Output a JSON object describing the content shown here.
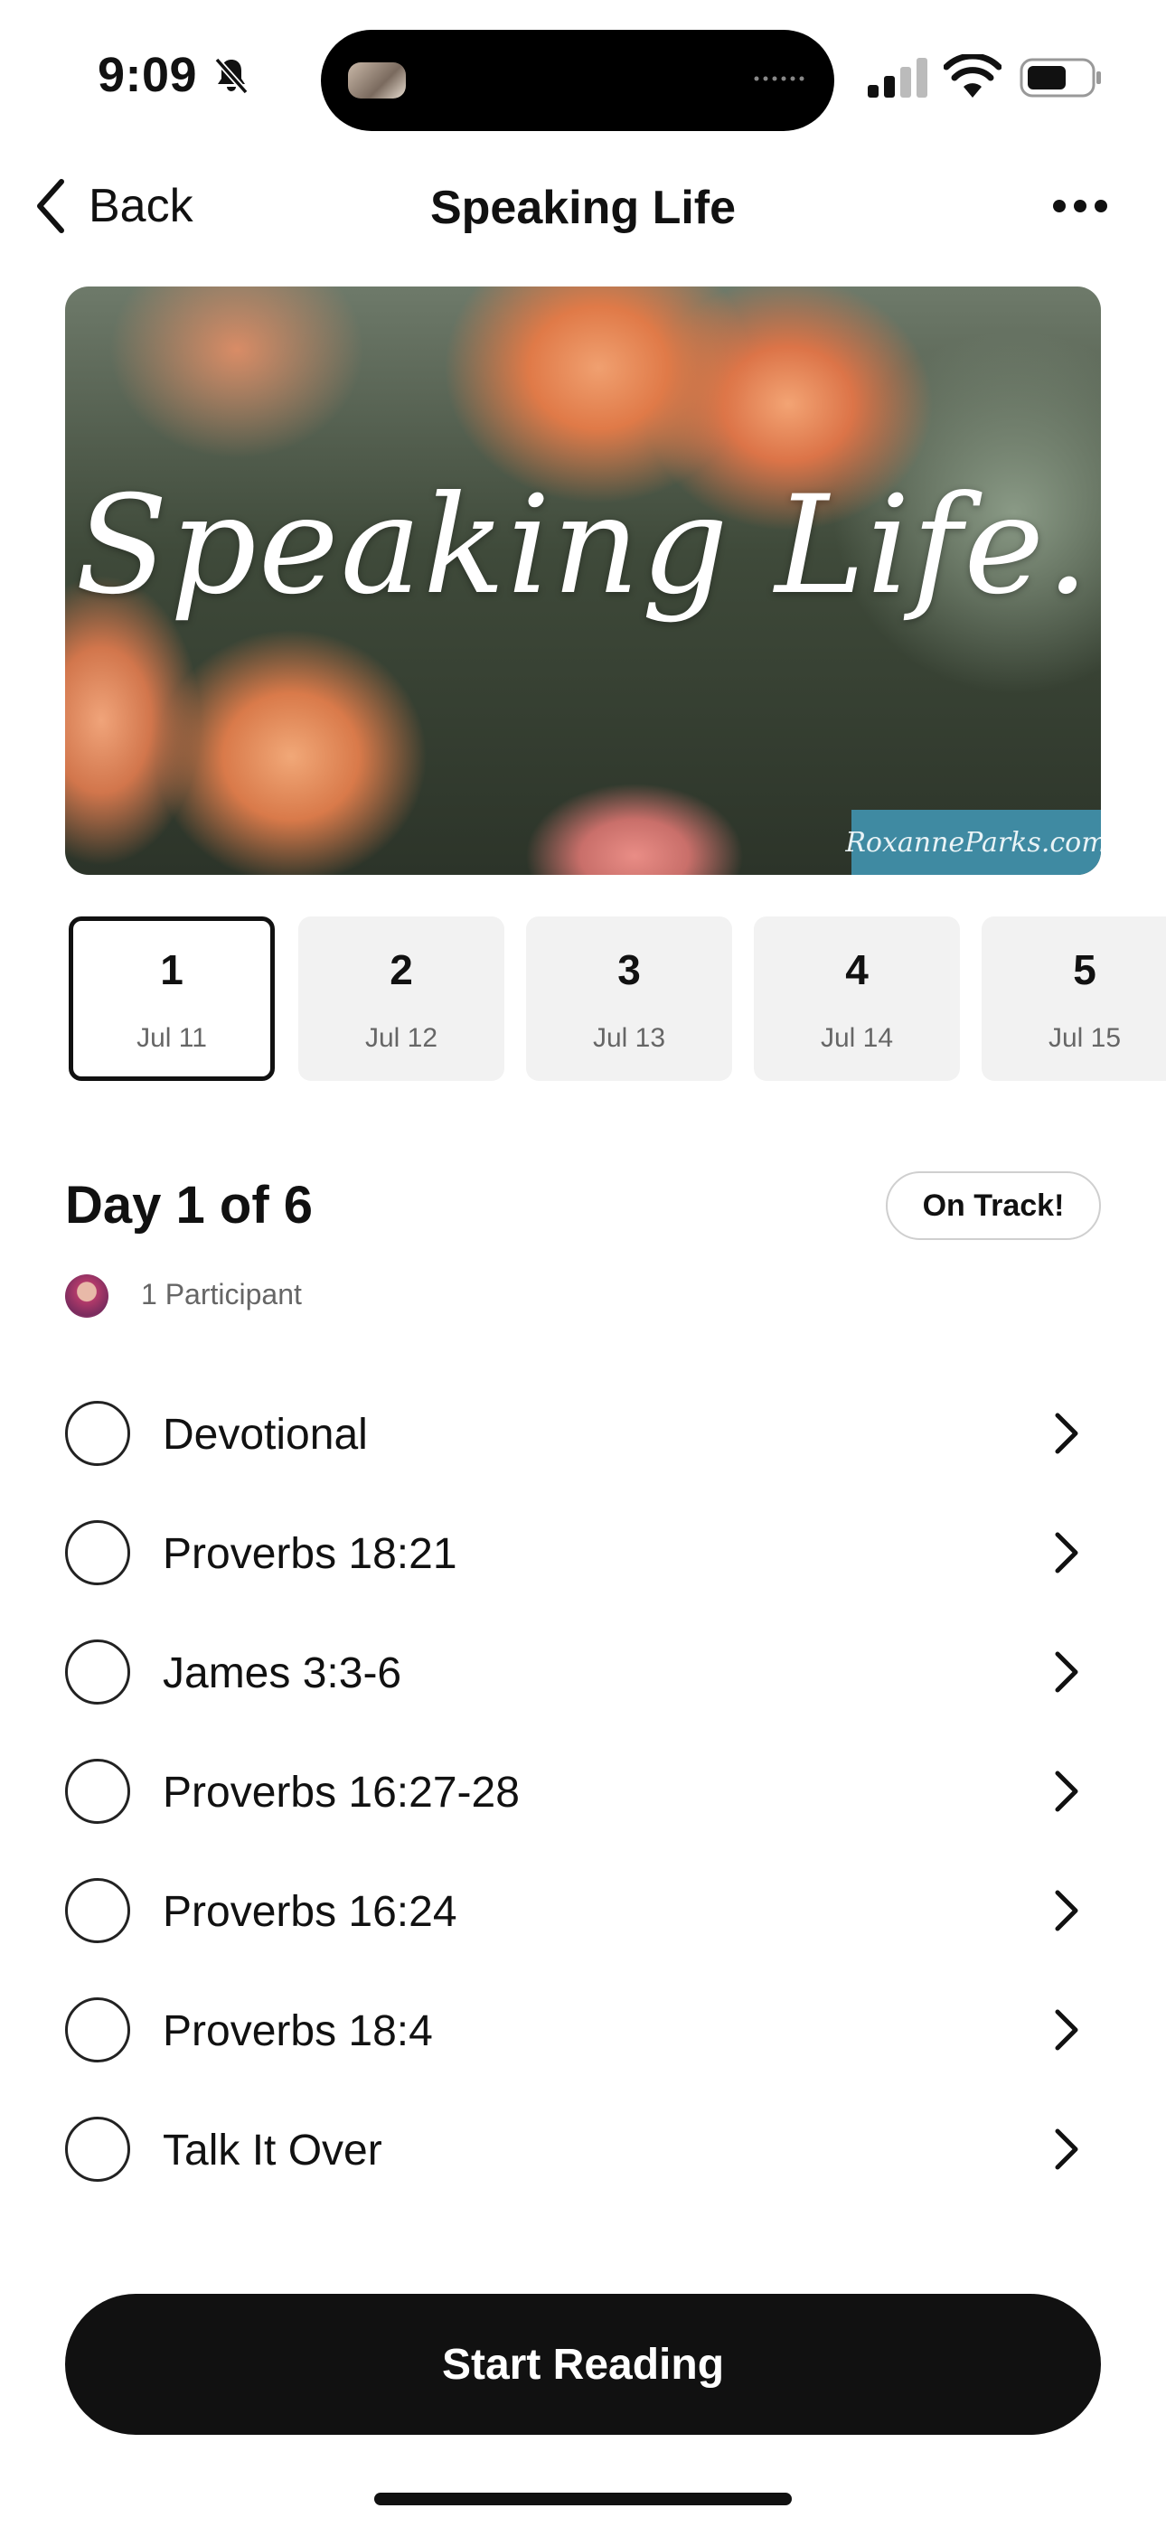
{
  "status_bar": {
    "time": "9:09"
  },
  "nav": {
    "back_label": "Back",
    "title": "Speaking Life"
  },
  "hero": {
    "title": "Speaking Life.",
    "watermark": "RoxanneParks.com"
  },
  "days": [
    {
      "num": "1",
      "date": "Jul 11",
      "selected": true
    },
    {
      "num": "2",
      "date": "Jul 12",
      "selected": false
    },
    {
      "num": "3",
      "date": "Jul 13",
      "selected": false
    },
    {
      "num": "4",
      "date": "Jul 14",
      "selected": false
    },
    {
      "num": "5",
      "date": "Jul 15",
      "selected": false
    }
  ],
  "day_header": {
    "title": "Day 1 of 6",
    "status": "On Track!",
    "participants": "1 Participant"
  },
  "readings": [
    {
      "label": "Devotional"
    },
    {
      "label": "Proverbs 18:21"
    },
    {
      "label": "James 3:3-6"
    },
    {
      "label": "Proverbs 16:27-28"
    },
    {
      "label": "Proverbs 16:24"
    },
    {
      "label": "Proverbs 18:4"
    },
    {
      "label": "Talk It Over"
    }
  ],
  "actions": {
    "start_label": "Start Reading"
  }
}
